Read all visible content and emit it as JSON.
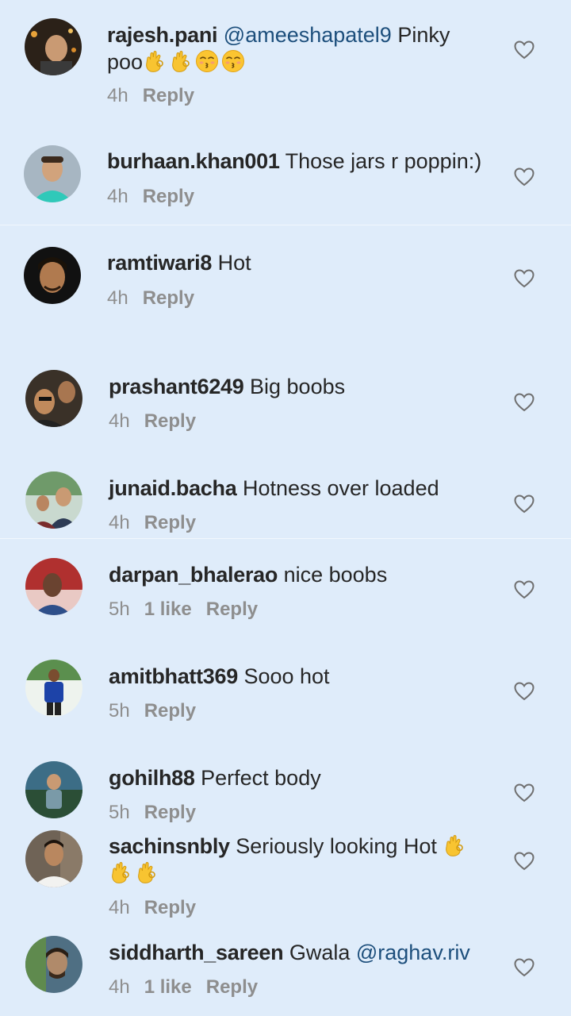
{
  "comments": [
    {
      "username": "rajesh.pani",
      "mention": "@ameeshapatel9",
      "text": "Pinky",
      "text2": "poo",
      "time": "4h",
      "likes": "",
      "reply": "Reply"
    },
    {
      "username": "burhaan.khan001",
      "mention": "",
      "text": "Those jars r poppin:)",
      "time": "4h",
      "likes": "",
      "reply": "Reply"
    },
    {
      "username": "ramtiwari8",
      "mention": "",
      "text": "Hot",
      "time": "4h",
      "likes": "",
      "reply": "Reply"
    },
    {
      "username": "prashant6249",
      "mention": "",
      "text": "Big boobs",
      "time": "4h",
      "likes": "",
      "reply": "Reply"
    },
    {
      "username": "junaid.bacha",
      "mention": "",
      "text": "Hotness over loaded",
      "time": "4h",
      "likes": "",
      "reply": "Reply"
    },
    {
      "username": "darpan_bhalerao",
      "mention": "",
      "text": "nice boobs",
      "time": "5h",
      "likes": "1 like",
      "reply": "Reply"
    },
    {
      "username": "amitbhatt369",
      "mention": "",
      "text": "Sooo hot",
      "time": "5h",
      "likes": "",
      "reply": "Reply"
    },
    {
      "username": "gohilh88",
      "mention": "",
      "text": "Perfect body",
      "time": "5h",
      "likes": "",
      "reply": "Reply"
    },
    {
      "username": "sachinsnbly",
      "mention": "",
      "text": "Seriously looking Hot",
      "time": "4h",
      "likes": "",
      "reply": "Reply"
    },
    {
      "username": "siddharth_sareen",
      "mention": "@raghav.riv",
      "text": "Gwala",
      "time": "4h",
      "likes": "1 like",
      "reply": "Reply"
    }
  ],
  "icons": {
    "like": "heart-outline-icon",
    "ok_hand": "ok-hand-emoji-icon",
    "kissing": "kissing-face-emoji-icon"
  },
  "colors": {
    "background": "#dfecfa",
    "username": "#262626",
    "meta": "#8e8e8e",
    "mention": "#1d4f7c"
  }
}
